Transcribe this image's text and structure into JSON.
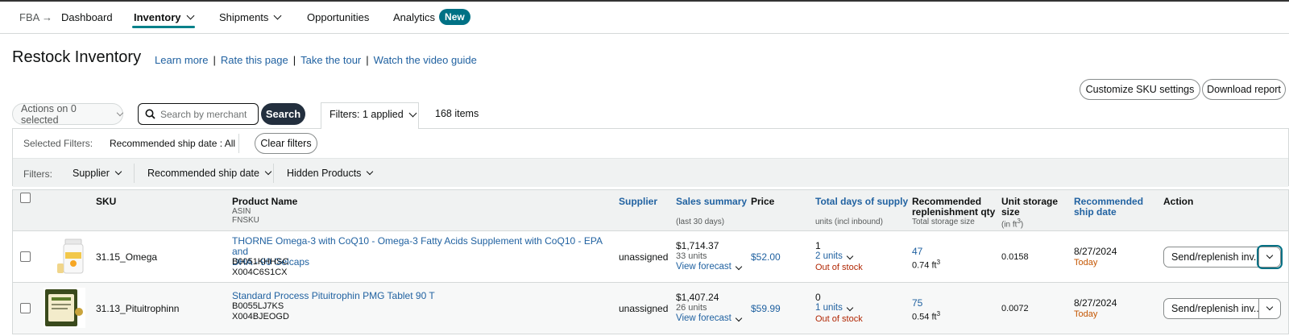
{
  "nav": {
    "breadcrumb_root": "FBA",
    "breadcrumb_arrow": "→",
    "dashboard": "Dashboard",
    "inventory": "Inventory",
    "shipments": "Shipments",
    "opportunities": "Opportunities",
    "analytics": "Analytics",
    "new_badge": "New"
  },
  "page": {
    "title": "Restock Inventory",
    "links": [
      "Learn more",
      "Rate this page",
      "Take the tour",
      "Watch the video guide"
    ],
    "separator": "|"
  },
  "toolbar": {
    "customize": "Customize SKU settings",
    "download": "Download report",
    "actions": "Actions on 0 selected",
    "search_placeholder": "Search by merchant SKU",
    "search_button": "Search",
    "filters_applied": "Filters: 1 applied",
    "items_count": "168 items"
  },
  "selected_filters": {
    "label": "Selected Filters:",
    "value": "Recommended ship date : All",
    "clear": "Clear filters"
  },
  "filters": {
    "label": "Filters:",
    "supplier": "Supplier",
    "ship_date": "Recommended ship date",
    "hidden": "Hidden Products"
  },
  "table": {
    "headers": {
      "sku": "SKU",
      "product": "Product Name",
      "product_sub1": "ASIN",
      "product_sub2": "FNSKU",
      "supplier": "Supplier",
      "sales": "Sales summary",
      "sales_sub": "(last 30 days)",
      "price": "Price",
      "days": "Total days of supply",
      "days_sub": "units (incl inbound)",
      "recommended_1": "Recommended",
      "recommended_2": "replenishment qty",
      "recommended_sub": "Total storage size",
      "unit_storage_1": "Unit storage",
      "unit_storage_2": "size",
      "unit_storage_sub": "(in ft",
      "ship_1": "Recommended",
      "ship_2": "ship date",
      "action": "Action"
    },
    "rows": [
      {
        "sku": "31.15_Omega",
        "product_line1": "THORNE Omega-3 with CoQ10 - Omega-3 Fatty Acids Supplement with CoQ10 - EPA and",
        "product_line2": "DHA - 90 Gelcaps",
        "asin": "B0051KHHSC",
        "fnsku": "X004C6S1CX",
        "supplier": "unassigned",
        "sales": "$1,714.37",
        "units": "33 units",
        "forecast": "View forecast",
        "price": "$52.00",
        "days": "1",
        "days_units": "2 units",
        "stock": "Out of stock",
        "rec_qty": "47",
        "storage": "0.74 ft",
        "unit_storage": "0.0158",
        "ship_date": "8/27/2024",
        "ship_when": "Today",
        "action": "Send/replenish inv..."
      },
      {
        "sku": "31.13_Pituitrophinn",
        "product_line1": "Standard Process Pituitrophin PMG Tablet 90 T",
        "product_line2": "",
        "asin": "B0055LJ7KS",
        "fnsku": "X004BJEOGD",
        "supplier": "unassigned",
        "sales": "$1,407.24",
        "units": "26 units",
        "forecast": "View forecast",
        "price": "$59.99",
        "days": "0",
        "days_units": "1 units",
        "stock": "Out of stock",
        "rec_qty": "75",
        "storage": "0.54 ft",
        "unit_storage": "0.0072",
        "ship_date": "8/27/2024",
        "ship_when": "Today",
        "action": "Send/replenish inv..."
      }
    ]
  }
}
